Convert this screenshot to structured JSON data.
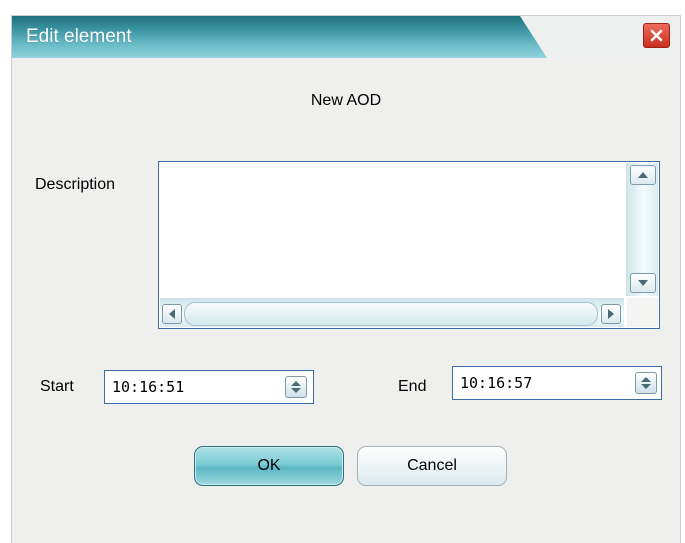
{
  "window": {
    "title": "Edit element",
    "close_label": "×"
  },
  "dialog": {
    "subtitle": "New AOD"
  },
  "description": {
    "label": "Description",
    "value": ""
  },
  "start": {
    "label": "Start",
    "value": "10:16:51"
  },
  "end": {
    "label": "End",
    "value": "10:16:57"
  },
  "buttons": {
    "ok": "OK",
    "cancel": "Cancel"
  },
  "icons": {
    "close": "close-icon",
    "scroll_up": "arrow-up-icon",
    "scroll_down": "arrow-down-icon",
    "scroll_left": "arrow-left-icon",
    "scroll_right": "arrow-right-icon",
    "spin": "spin-updown-icon"
  },
  "colors": {
    "titlebar": "#3e98a6",
    "close_button": "#d9422f",
    "ok_button": "#7ccbd4",
    "field_border": "#3d6aa8"
  }
}
